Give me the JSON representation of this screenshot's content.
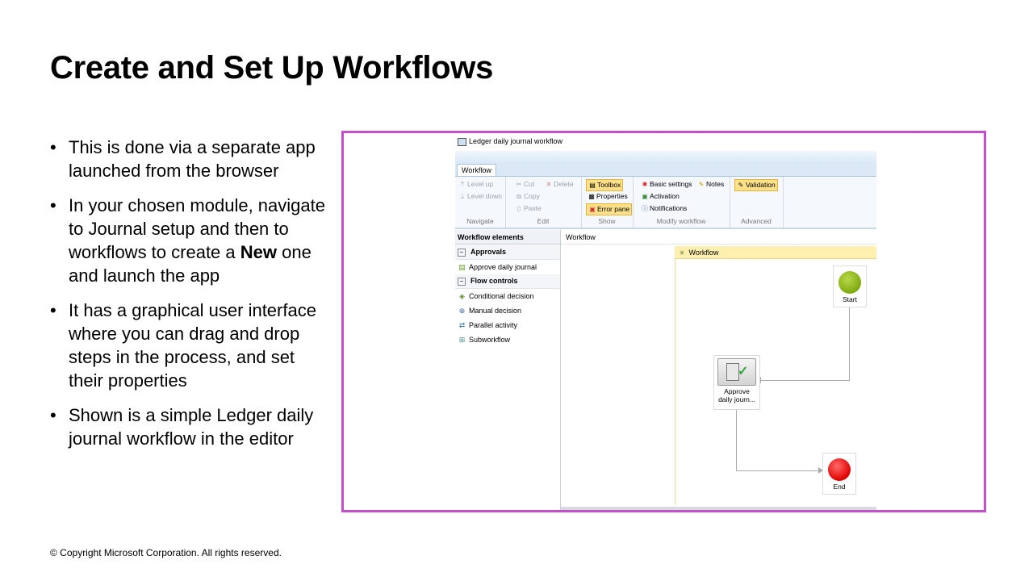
{
  "slide": {
    "title": "Create and Set Up Workflows",
    "bullets": [
      {
        "text": "This is done via a separate app launched from the browser"
      },
      {
        "text": "In your chosen module, navigate to Journal setup and then to workflows to create a ",
        "bold": "New",
        "after": " one and launch the app"
      },
      {
        "text": "It has a graphical user interface where you can drag and drop steps in the process, and set their properties"
      },
      {
        "text": "Shown is a simple Ledger daily journal workflow in the editor"
      }
    ],
    "copyright": "© Copyright Microsoft Corporation. All rights reserved.",
    "frame_color": "#c34fcb"
  },
  "app": {
    "window_title": "Ledger daily journal workflow",
    "tab": "Workflow",
    "ribbon": {
      "navigate": {
        "label": "Navigate",
        "level_up": "Level up",
        "level_down": "Level down"
      },
      "edit": {
        "label": "Edit",
        "cut": "Cut",
        "delete": "Delete",
        "copy": "Copy",
        "paste": "Paste"
      },
      "show": {
        "label": "Show",
        "toolbox": "Toolbox",
        "properties": "Properties",
        "error_pane": "Error pane"
      },
      "modify": {
        "label": "Modify workflow",
        "basic_settings": "Basic settings",
        "notes": "Notes",
        "activation": "Activation",
        "notifications": "Notifications"
      },
      "advanced": {
        "label": "Advanced",
        "validation": "Validation"
      }
    },
    "sidebar": {
      "header": "Workflow elements",
      "approvals": {
        "label": "Approvals",
        "items": [
          "Approve daily journal"
        ]
      },
      "flow_controls": {
        "label": "Flow controls",
        "items": [
          "Conditional decision",
          "Manual decision",
          "Parallel activity",
          "Subworkflow"
        ]
      }
    },
    "canvas": {
      "header": "Workflow",
      "lane_label": "Workflow",
      "start": {
        "label": "Start",
        "color": "#7faa10"
      },
      "approve": {
        "label_line1": "Approve",
        "label_line2": "daily journ..."
      },
      "end": {
        "label": "End",
        "color": "#e00000"
      }
    }
  }
}
